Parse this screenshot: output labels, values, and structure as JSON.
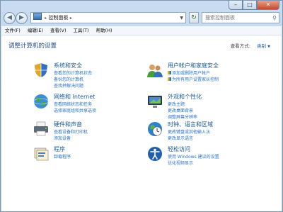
{
  "address": {
    "location": "控制面板"
  },
  "search": {
    "placeholder": "搜索控制面板"
  },
  "menu": [
    "文件(F)",
    "编辑(E)",
    "查看(V)",
    "工具(T)",
    "帮助(H)"
  ],
  "main": {
    "heading": "调整计算机的设置",
    "view_by_label": "查看方式:",
    "view_by_value": "类别"
  },
  "categories": [
    {
      "title": "系统和安全",
      "links": [
        "查看您的计算机状态",
        "备份您的计算机",
        "查找并解决问题"
      ]
    },
    {
      "title": "用户帐户和家庭安全",
      "links": [
        "添加或删除用户帐户",
        "为所有用户设置家长控制"
      ]
    },
    {
      "title": "网络和 Internet",
      "links": [
        "查看网络状态和任务",
        "选择家庭组和共享选项"
      ]
    },
    {
      "title": "外观和个性化",
      "links": [
        "更改主题",
        "更改桌面背景",
        "调整屏幕分辨率"
      ]
    },
    {
      "title": "硬件和声音",
      "links": [
        "查看设备和打印机",
        "添加设备"
      ]
    },
    {
      "title": "时钟、语言和区域",
      "links": [
        "更改键盘或其他输入法",
        "更改显示语言"
      ]
    },
    {
      "title": "程序",
      "links": [
        "卸载程序"
      ]
    },
    {
      "title": "轻松访问",
      "links": [
        "使用 Windows 建议的设置",
        "优化视频显示"
      ]
    }
  ]
}
